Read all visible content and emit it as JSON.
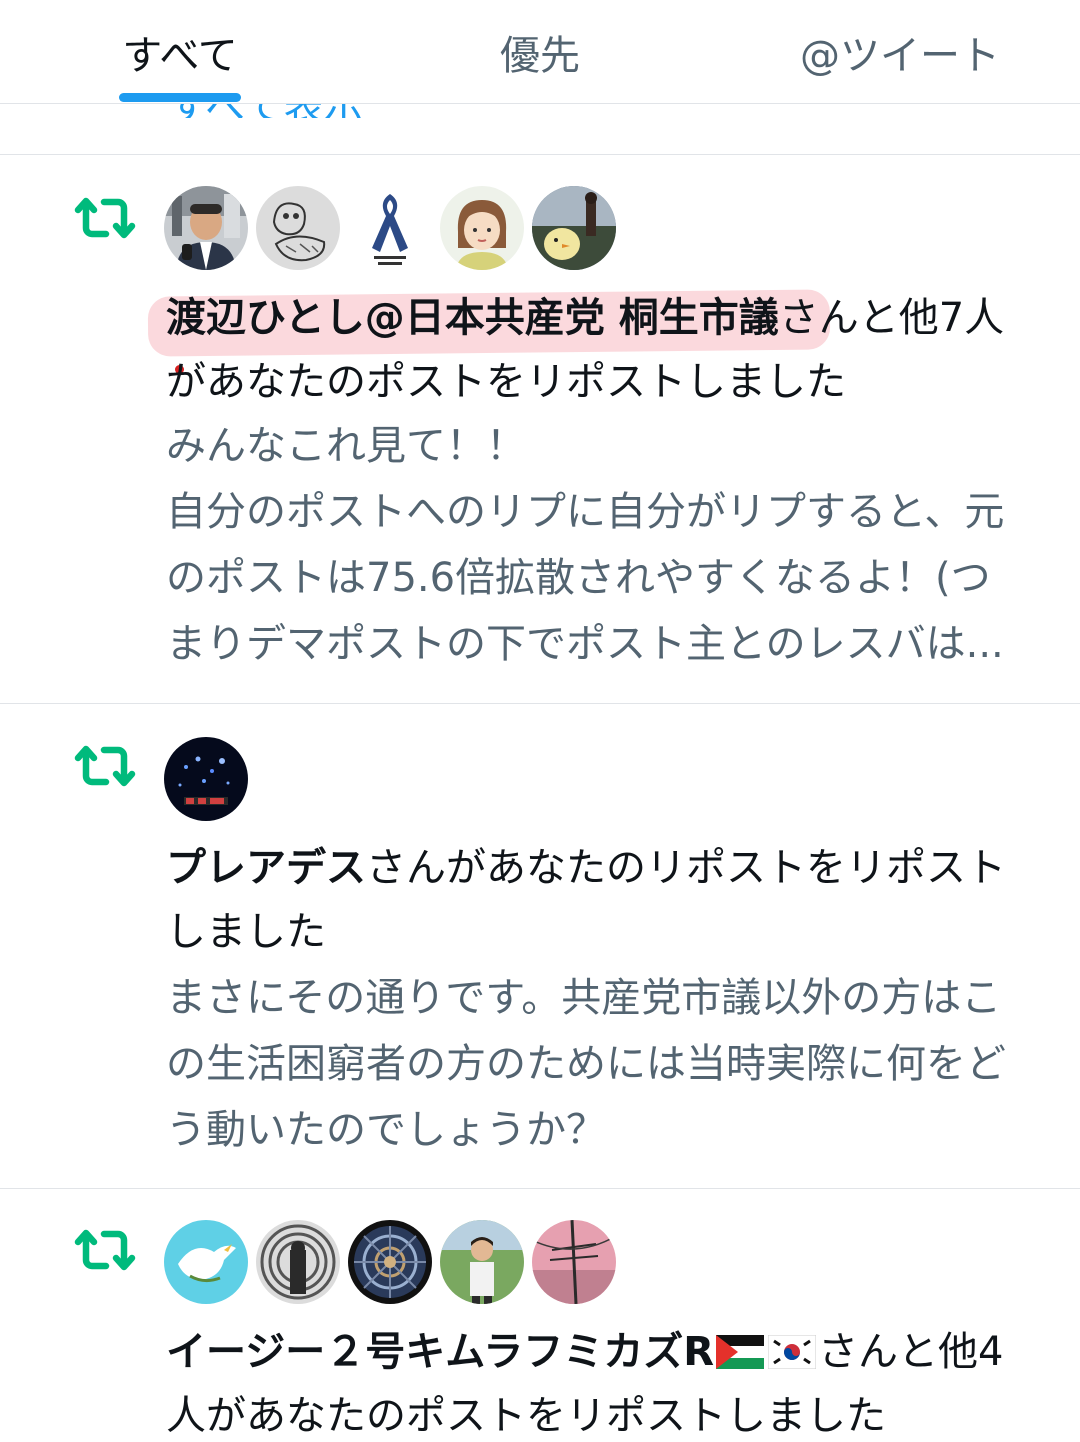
{
  "tabs": [
    {
      "label": "すべて",
      "active": true
    },
    {
      "label": "優先",
      "active": false
    },
    {
      "label": "@ツイート",
      "active": false
    }
  ],
  "clipped_link": "すべて表示",
  "accent_color": "#1d9bf0",
  "repost_color": "#00ba7c",
  "notifications": [
    {
      "type": "repost",
      "avatar_count": 5,
      "name": "渡辺ひとし@日本共産党 桐生市議",
      "header_rest_1": "さんと他7人",
      "header_line_2": "があなたのポストをリポストしました",
      "body_lines": [
        "みんなこれ見て！！",
        "自分のポストへのリプに自分がリプすると、元",
        "のポストは75.6倍拡散されやすくなるよ！(つ",
        "まりデマポストの下でポスト主とのレスバは..."
      ]
    },
    {
      "type": "repost",
      "avatar_count": 1,
      "name": "プレアデス",
      "header_rest_1": "さんがあなたのリポストをリポスト",
      "header_line_2": "しました",
      "body_lines": [
        "まさにその通りです。共産党市議以外の方はこ",
        "の生活困窮者の方のためには当時実際に何をど",
        "う動いたのでしょうか？"
      ]
    },
    {
      "type": "repost",
      "avatar_count": 5,
      "name": "イージー２号キムラフミカズR",
      "header_rest_1": "さんと他4",
      "header_line_2": "人があなたのポストをリポストしました"
    }
  ]
}
